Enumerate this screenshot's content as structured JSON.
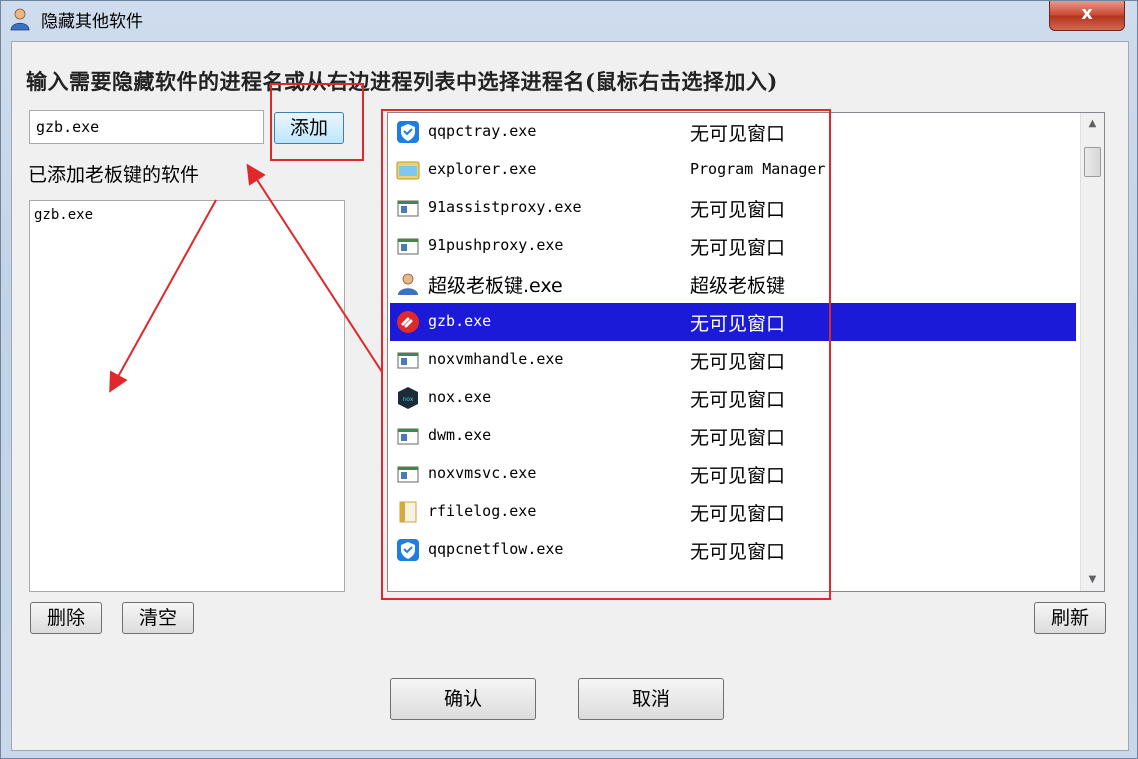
{
  "window": {
    "title": "隐藏其他软件",
    "close_label": "x"
  },
  "instruction": "输入需要隐藏软件的进程名或从右边进程列表中选择进程名(鼠标右击选择加入)",
  "name_input": {
    "value": "gzb.exe"
  },
  "add_button": "添加",
  "added_label": "已添加老板键的软件",
  "added_items": [
    "gzb.exe"
  ],
  "processes": [
    {
      "name": "qqpctray.exe",
      "title": "无可见窗口",
      "icon": "shield-icon",
      "selected": false
    },
    {
      "name": "explorer.exe",
      "title": "Program Manager",
      "icon": "folder-icon",
      "selected": false
    },
    {
      "name": "91assistproxy.exe",
      "title": "无可见窗口",
      "icon": "app-icon",
      "selected": false
    },
    {
      "name": "91pushproxy.exe",
      "title": "无可见窗口",
      "icon": "app-icon",
      "selected": false
    },
    {
      "name": "超级老板键.exe",
      "title": "超级老板键",
      "icon": "user-icon",
      "selected": false
    },
    {
      "name": "gzb.exe",
      "title": "无可见窗口",
      "icon": "link-icon",
      "selected": true
    },
    {
      "name": "noxvmhandle.exe",
      "title": "无可见窗口",
      "icon": "app-icon",
      "selected": false
    },
    {
      "name": "nox.exe",
      "title": "无可见窗口",
      "icon": "nox-icon",
      "selected": false
    },
    {
      "name": "dwm.exe",
      "title": "无可见窗口",
      "icon": "app-icon",
      "selected": false
    },
    {
      "name": "noxvmsvc.exe",
      "title": "无可见窗口",
      "icon": "app-icon",
      "selected": false
    },
    {
      "name": "rfilelog.exe",
      "title": "无可见窗口",
      "icon": "file-icon",
      "selected": false
    },
    {
      "name": "qqpcnetflow.exe",
      "title": "无可见窗口",
      "icon": "shield-icon",
      "selected": false
    }
  ],
  "buttons": {
    "delete": "删除",
    "clear": "清空",
    "refresh": "刷新",
    "confirm": "确认",
    "cancel": "取消"
  },
  "colors": {
    "selection": "#1a1ad8",
    "annotation": "#e0282a"
  }
}
